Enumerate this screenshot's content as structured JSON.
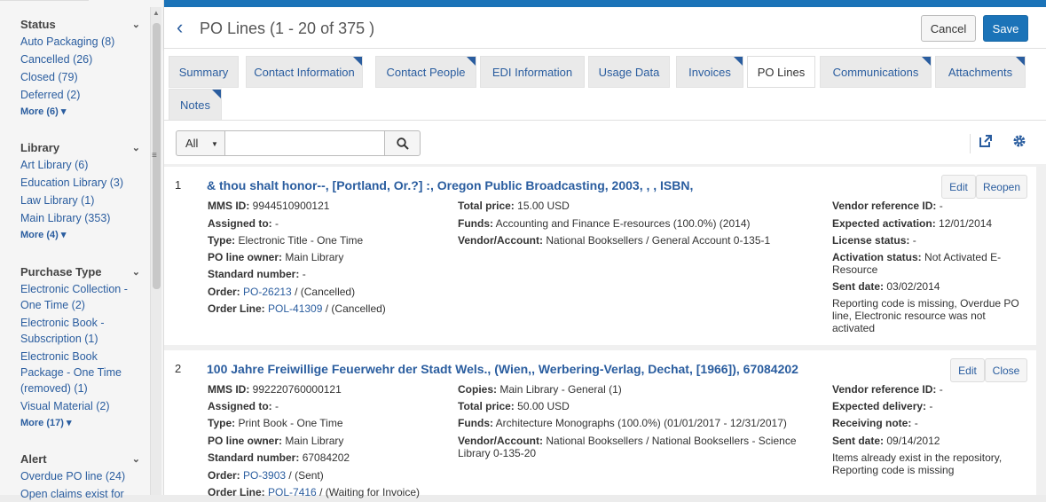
{
  "sidebar": {
    "facets": [
      {
        "title": "Status",
        "items": [
          "Auto Packaging (8)",
          "Cancelled (26)",
          "Closed (79)",
          "Deferred (2)"
        ],
        "more": "More (6)"
      },
      {
        "title": "Library",
        "items": [
          "Art Library (6)",
          "Education Library (3)",
          "Law Library (1)",
          "Main Library (353)"
        ],
        "more": "More (4)"
      },
      {
        "title": "Purchase Type",
        "items": [
          "Electronic Collection - One Time (2)",
          "Electronic Book - Subscription (1)",
          "Electronic Book Package - One Time (removed) (1)",
          "Visual Material (2)"
        ],
        "more": "More (17)"
      },
      {
        "title": "Alert",
        "items": [
          "Overdue PO line (24)",
          "Open claims exist for"
        ],
        "more": ""
      }
    ]
  },
  "header": {
    "title": "PO Lines (1 - 20 of 375 )",
    "cancel": "Cancel",
    "save": "Save"
  },
  "tabs": [
    "Summary",
    "Contact Information",
    "Contact People",
    "EDI Information",
    "Usage Data",
    "Invoices",
    "PO Lines",
    "Communications",
    "Attachments",
    "Notes"
  ],
  "search": {
    "scope": "All",
    "value": ""
  },
  "rows": [
    {
      "num": "1",
      "title": "& thou shalt honor--, [Portland, Or.?] :, Oregon Public Broadcasting, 2003, , , ISBN,",
      "buttons": [
        "Edit",
        "Reopen"
      ],
      "col1": [
        {
          "label": "MMS ID:",
          "value": "9944510900121"
        },
        {
          "label": "Assigned to:",
          "value": "-"
        },
        {
          "label": "Type:",
          "value": "Electronic Title - One Time"
        },
        {
          "label": "PO line owner:",
          "value": "Main Library"
        },
        {
          "label": "Standard number:",
          "value": "-"
        },
        {
          "label": "Order:",
          "link": "PO-26213",
          "value": "/ (Cancelled)"
        },
        {
          "label": "Order Line:",
          "link": "POL-41309",
          "value": "/ (Cancelled)"
        }
      ],
      "col2": [
        {
          "label": "Total price:",
          "value": "15.00 USD"
        },
        {
          "label": "Funds:",
          "value": "Accounting and Finance E-resources (100.0%) (2014)"
        },
        {
          "label": "Vendor/Account:",
          "value": "National Booksellers / General Account 0-135-1"
        }
      ],
      "col3": [
        {
          "label": "Vendor reference ID:",
          "value": "-"
        },
        {
          "label": "Expected activation:",
          "value": "12/01/2014"
        },
        {
          "label": "License status:",
          "value": "-"
        },
        {
          "label": "Activation status:",
          "value": "Not Activated E-Resource"
        },
        {
          "label": "Sent date:",
          "value": "03/02/2014"
        },
        {
          "label": "",
          "value": "Reporting code is missing, Overdue PO line, Electronic resource was not activated"
        }
      ]
    },
    {
      "num": "2",
      "title": "100 Jahre Freiwillige Feuerwehr der Stadt Wels., (Wien,, Werbering-Verlag, Dechat, [1966]), 67084202",
      "buttons": [
        "Edit",
        "Close"
      ],
      "col1": [
        {
          "label": "MMS ID:",
          "value": "992220760000121"
        },
        {
          "label": "Assigned to:",
          "value": "-"
        },
        {
          "label": "Type:",
          "value": "Print Book - One Time"
        },
        {
          "label": "PO line owner:",
          "value": "Main Library"
        },
        {
          "label": "Standard number:",
          "value": "67084202"
        },
        {
          "label": "Order:",
          "link": "PO-3903",
          "value": "/ (Sent)"
        },
        {
          "label": "Order Line:",
          "link": "POL-7416",
          "value": "/ (Waiting for Invoice)"
        }
      ],
      "col2": [
        {
          "label": "Copies:",
          "value": "Main Library - General (1)"
        },
        {
          "label": "Total price:",
          "value": "50.00 USD"
        },
        {
          "label": "Funds:",
          "value": "Architecture Monographs (100.0%) (01/01/2017 - 12/31/2017)"
        },
        {
          "label": "Vendor/Account:",
          "value": "National Booksellers / National Booksellers - Science Library 0-135-20"
        }
      ],
      "col3": [
        {
          "label": "Vendor reference ID:",
          "value": "-"
        },
        {
          "label": "Expected delivery:",
          "value": "-"
        },
        {
          "label": "Receiving note:",
          "value": "-"
        },
        {
          "label": "Sent date:",
          "value": "09/14/2012"
        },
        {
          "label": "",
          "value": "Items already exist in the repository, Reporting code is missing"
        }
      ]
    }
  ]
}
